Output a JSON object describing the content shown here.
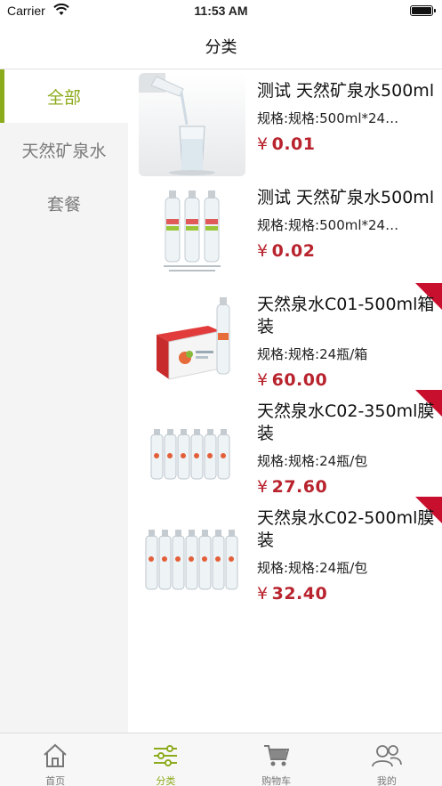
{
  "status_bar": {
    "carrier": "Carrier",
    "time": "11:53 AM"
  },
  "nav": {
    "title": "分类"
  },
  "categories": [
    {
      "label": "全部",
      "active": true
    },
    {
      "label": "天然矿泉水",
      "active": false
    },
    {
      "label": "套餐",
      "active": false
    }
  ],
  "products": [
    {
      "name": "测试 天然矿泉水500ml",
      "spec": "规格:规格:500ml*24…",
      "currency": "¥",
      "price": "0.01",
      "image": "water-pour-image",
      "ribbon": false
    },
    {
      "name": "测试 天然矿泉水500ml",
      "spec": "规格:规格:500ml*24…",
      "currency": "¥",
      "price": "0.02",
      "image": "three-bottles-image",
      "ribbon": false
    },
    {
      "name": "天然泉水C01-500ml箱装",
      "spec": "规格:规格:24瓶/箱",
      "currency": "¥",
      "price": "60.00",
      "image": "water-box-image",
      "ribbon": true
    },
    {
      "name": "天然泉水C02-350ml膜装",
      "spec": "规格:规格:24瓶/包",
      "currency": "¥",
      "price": "27.60",
      "image": "bottle-pack-image",
      "ribbon": true
    },
    {
      "name": "天然泉水C02-500ml膜装",
      "spec": "规格:规格:24瓶/包",
      "currency": "¥",
      "price": "32.40",
      "image": "bottle-pack-image",
      "ribbon": true
    }
  ],
  "tabs": [
    {
      "label": "首页",
      "icon": "home-icon",
      "active": false
    },
    {
      "label": "分类",
      "icon": "sliders-icon",
      "active": true
    },
    {
      "label": "购物车",
      "icon": "cart-icon",
      "active": false
    },
    {
      "label": "我的",
      "icon": "users-icon",
      "active": false
    }
  ],
  "colors": {
    "accent": "#8cab1c",
    "price": "#b8232d",
    "ribbon": "#c8102e",
    "sidebar_bg": "#f4f4f4"
  }
}
